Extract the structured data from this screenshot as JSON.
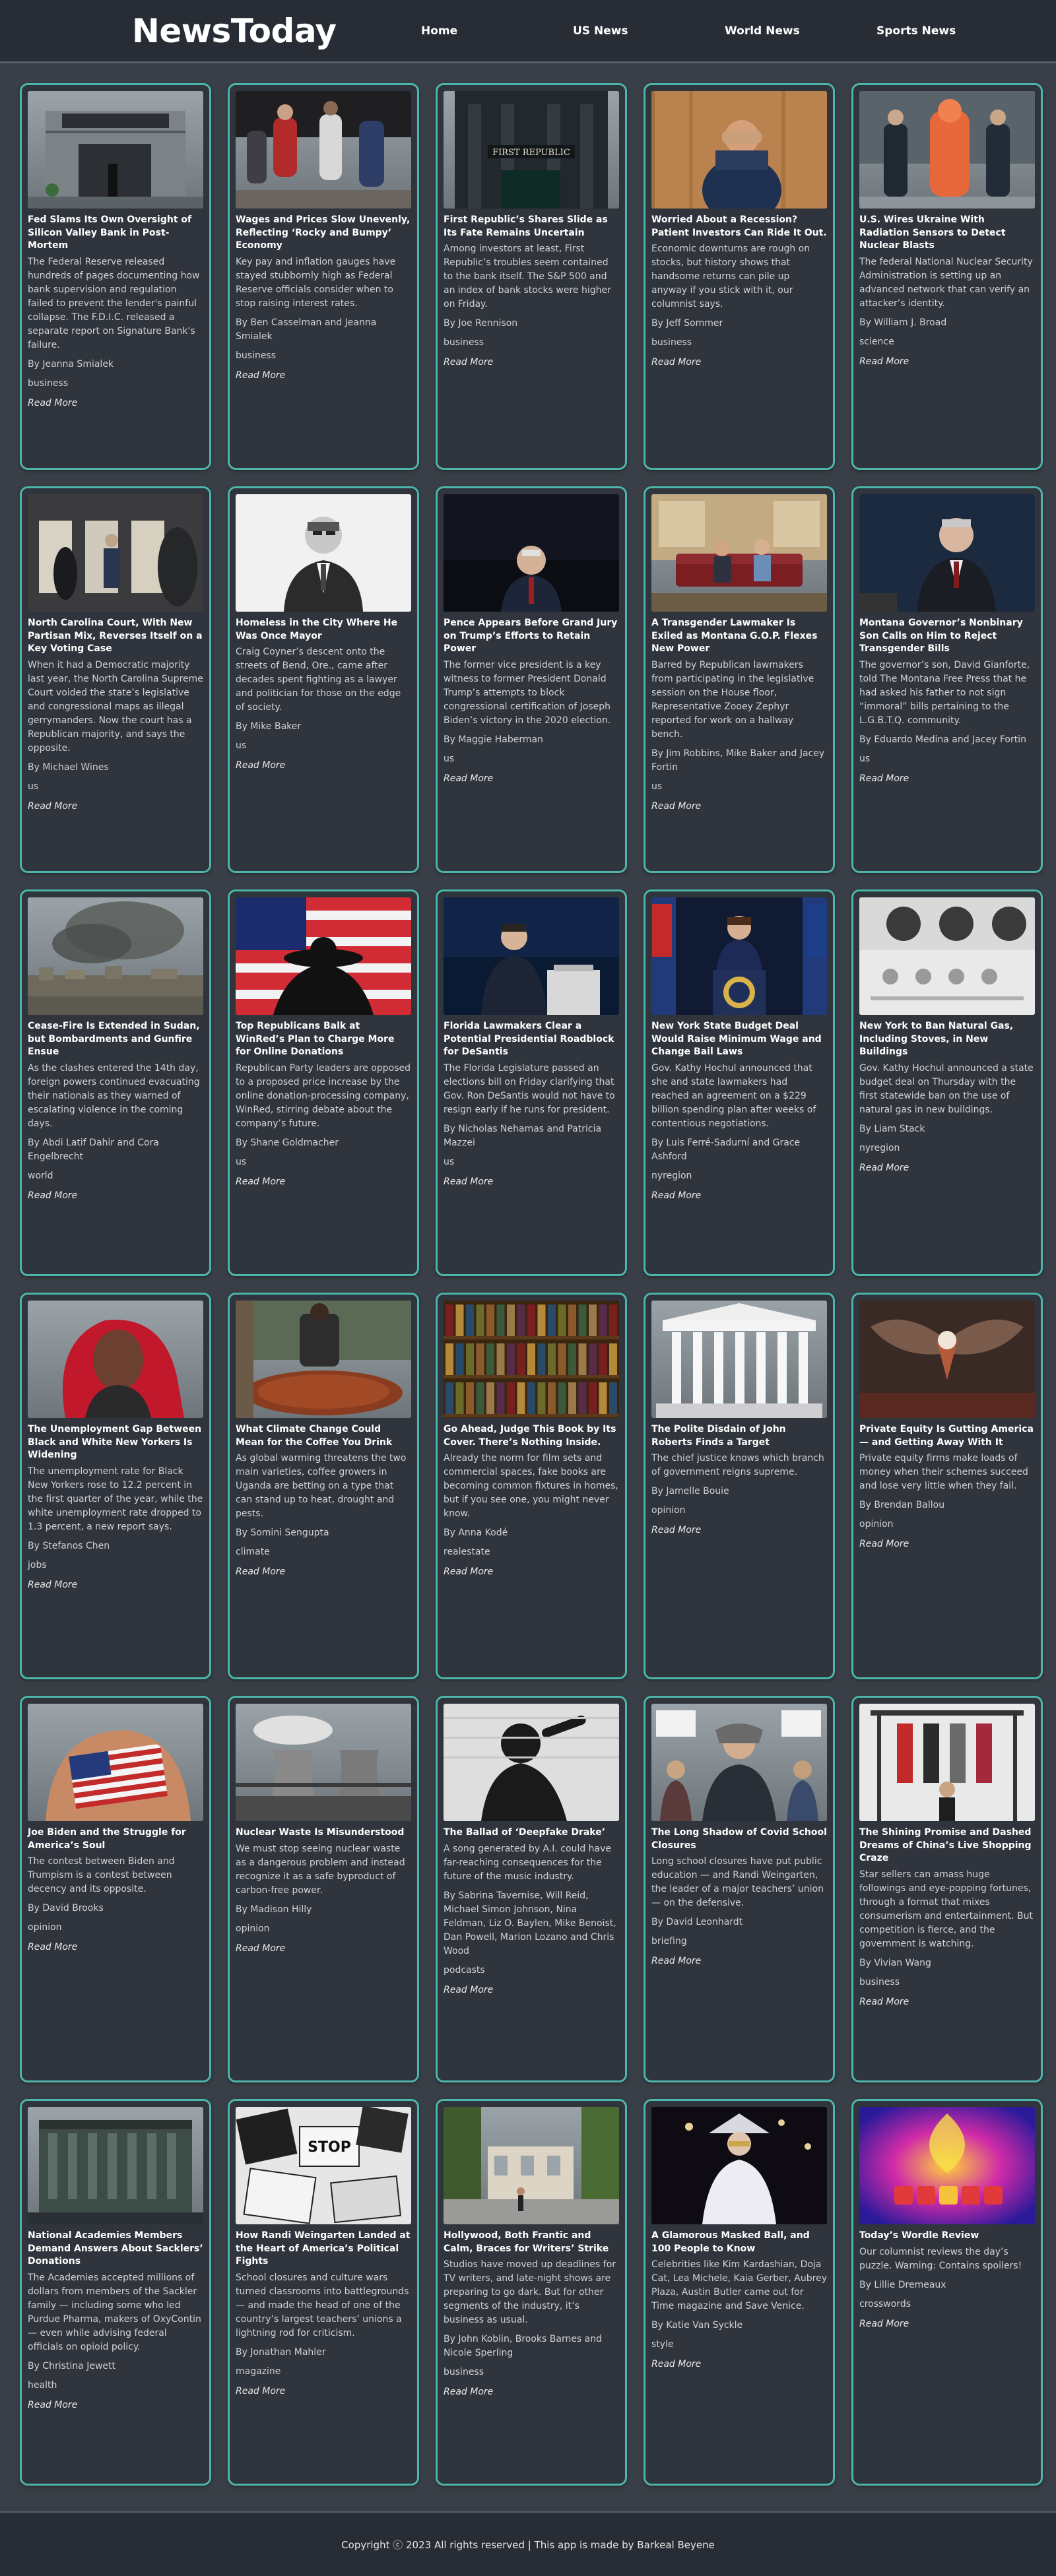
{
  "header": {
    "brand": "NewsToday",
    "nav": [
      "Home",
      "US News",
      "World News",
      "Sports News"
    ]
  },
  "read_more_label": "Read More",
  "articles": [
    {
      "title": "Fed Slams Its Own Oversight of Silicon Valley Bank in Post-Mortem",
      "summary": "The Federal Reserve released hundreds of pages documenting how bank supervision and regulation failed to prevent the lender's painful collapse. The F.D.I.C. released a separate report on Signature Bank's failure.",
      "byline": "By Jeanna Smialek",
      "section": "business",
      "image": "bank-building",
      "sign": "Silicon Valley Bank"
    },
    {
      "title": "Wages and Prices Slow Unevenly, Reflecting ‘Rocky and Bumpy’ Economy",
      "summary": "Key pay and inflation gauges have stayed stubbornly high as Federal Reserve officials consider when to stop raising interest rates.",
      "byline": "By Ben Casselman and Jeanna Smialek",
      "section": "business",
      "image": "street-pedestrians"
    },
    {
      "title": "First Republic’s Shares Slide as Its Fate Remains Uncertain",
      "summary": "Among investors at least, First Republic’s troubles seem contained to the bank itself. The S&P 500 and an index of bank stocks were higher on Friday.",
      "byline": "By Joe Rennison",
      "section": "business",
      "image": "bank-facade",
      "sign": "FIRST REPUBLIC"
    },
    {
      "title": "Worried About a Recession? Patient Investors Can Ride It Out.",
      "summary": "Economic downturns are rough on stocks, but history shows that handsome returns can pile up anyway if you stick with it, our columnist says.",
      "byline": "By Jeff Sommer",
      "section": "business",
      "image": "worried-man"
    },
    {
      "title": "U.S. Wires Ukraine With Radiation Sensors to Detect Nuclear Blasts",
      "summary": "The federal National Nuclear Security Administration is setting up an advanced network that can verify an attacker’s identity.",
      "byline": "By William J. Broad",
      "section": "science",
      "image": "hazmat-suits"
    },
    {
      "title": "North Carolina Court, With New Partisan Mix, Reverses Itself on a Key Voting Case",
      "summary": "When it had a Democratic majority last year, the North Carolina Supreme Court voided the state’s legislative and congressional maps as illegal gerrymanders. Now the court has a Republican majority, and says the opposite.",
      "byline": "By Michael Wines",
      "section": "us",
      "image": "voting-booths"
    },
    {
      "title": "Homeless in the City Where He Was Once Mayor",
      "summary": "Craig Coyner’s descent onto the streets of Bend, Ore., came after decades spent fighting as a lawyer and politician for those on the edge of society.",
      "byline": "By Mike Baker",
      "section": "us",
      "image": "bw-portrait"
    },
    {
      "title": "Pence Appears Before Grand Jury on Trump’s Efforts to Retain Power",
      "summary": "The former vice president is a key witness to former President Donald Trump’s attempts to block congressional certification of Joseph Biden’s victory in the 2020 election.",
      "byline": "By Maggie Haberman",
      "section": "us",
      "image": "speaker-dark"
    },
    {
      "title": "A Transgender Lawmaker Is Exiled as Montana G.O.P. Flexes New Power",
      "summary": "Barred by Republican lawmakers from participating in the legislative session on the House floor, Representative Zooey Zephyr reported for work on a hallway bench.",
      "byline": "By Jim Robbins, Mike Baker and Jacey Fortin",
      "section": "us",
      "image": "bench"
    },
    {
      "title": "Montana Governor’s Nonbinary Son Calls on Him to Reject Transgender Bills",
      "summary": "The governor’s son, David Gianforte, told The Montana Free Press that he had asked his father to not sign “immoral” bills pertaining to the L.G.B.T.Q. community.",
      "byline": "By Eduardo Medina and Jacey Fortin",
      "section": "us",
      "image": "governor"
    },
    {
      "title": "Cease-Fire Is Extended in Sudan, but Bombardments and Gunfire Ensue",
      "summary": "As the clashes entered the 14th day, foreign powers continued evacuating their nationals as they warned of escalating violence in the coming days.",
      "byline": "By Abdi Latif Dahir and Cora Engelbrecht",
      "section": "world",
      "image": "smoke-city"
    },
    {
      "title": "Top Republicans Balk at WinRed’s Plan to Charge More for Online Donations",
      "summary": "Republican Party leaders are opposed to a proposed price increase by the online donation-processing company, WinRed, stirring debate about the company’s future.",
      "byline": "By Shane Goldmacher",
      "section": "us",
      "image": "flag-silhouette"
    },
    {
      "title": "Florida Lawmakers Clear a Potential Presidential Roadblock for DeSantis",
      "summary": "The Florida Legislature passed an elections bill on Friday clarifying that Gov. Ron DeSantis would not have to resign early if he runs for president.",
      "byline": "By Nicholas Nehamas and Patricia Mazzei",
      "section": "us",
      "image": "podium-speaker"
    },
    {
      "title": "New York State Budget Deal Would Raise Minimum Wage and Change Bail Laws",
      "summary": "Gov. Kathy Hochul announced that she and state lawmakers had reached an agreement on a $229 billion spending plan after weeks of contentious negotiations.",
      "byline": "By Luis Ferré-Sadurní and Grace Ashford",
      "section": "nyregion",
      "image": "governor-podium"
    },
    {
      "title": "New York to Ban Natural Gas, Including Stoves, in New Buildings",
      "summary": "Gov. Kathy Hochul announced a state budget deal on Thursday with the first statewide ban on the use of natural gas in new buildings.",
      "byline": "By Liam Stack",
      "section": "nyregion",
      "image": "gas-stove"
    },
    {
      "title": "The Unemployment Gap Between Black and White New Yorkers Is Widening",
      "summary": "The unemployment rate for Black New Yorkers rose to 12.2 percent in the first quarter of the year, while the white unemployment rate dropped to 1.3 percent, a new report says.",
      "byline": "By Stefanos Chen",
      "section": "jobs",
      "image": "red-hair"
    },
    {
      "title": "What Climate Change Could Mean for the Coffee You Drink",
      "summary": "As global warming threatens the two main varieties, coffee growers in Uganda are betting on a type that can stand up to heat, drought and pests.",
      "byline": "By Somini Sengupta",
      "section": "climate",
      "image": "coffee-beans"
    },
    {
      "title": "Go Ahead, Judge This Book by Its Cover. There’s Nothing Inside.",
      "summary": "Already the norm for film sets and commercial spaces, fake books are becoming common fixtures in homes, but if you see one, you might never know.",
      "byline": "By Anna Kodé",
      "section": "realestate",
      "image": "bookshelf"
    },
    {
      "title": "The Polite Disdain of John Roberts Finds a Target",
      "summary": "The chief justice knows which branch of government reigns supreme.",
      "byline": "By Jamelle Bouie",
      "section": "opinion",
      "image": "supreme-court"
    },
    {
      "title": "Private Equity Is Gutting America — and Getting Away With It",
      "summary": "Private equity firms make loads of money when their schemes succeed and lose very little when they fail.",
      "byline": "By Brendan Ballou",
      "section": "opinion",
      "image": "eagle-illustration"
    },
    {
      "title": "Joe Biden and the Struggle for America’s Soul",
      "summary": "The contest between Biden and Trumpism is a contest between decency and its opposite.",
      "byline": "By David Brooks",
      "section": "opinion",
      "image": "flag-patch"
    },
    {
      "title": "Nuclear Waste Is Misunderstood",
      "summary": "We must stop seeing nuclear waste as a dangerous problem and instead recognize it as a safe byproduct of carbon-free power.",
      "byline": "By Madison Hilly",
      "section": "opinion",
      "image": "cooling-towers"
    },
    {
      "title": "The Ballad of ‘Deepfake Drake’",
      "summary": "A song generated by A.I. could have far-reaching consequences for the future of the music industry.",
      "byline": "By Sabrina Tavernise, Will Reid, Michael Simon Johnson, Nina Feldman, Liz O. Baylen, Mike Benoist, Dan Powell, Marion Lozano and Chris Wood",
      "section": "podcasts",
      "image": "singer-silhouette"
    },
    {
      "title": "The Long Shadow of Covid School Closures",
      "summary": "Long school closures have put public education — and Randi Weingarten, the leader of a major teachers’ union — on the defensive.",
      "byline": "By David Leonhardt",
      "section": "briefing",
      "image": "protest"
    },
    {
      "title": "The Shining Promise and Dashed Dreams of China’s Live Shopping Craze",
      "summary": "Star sellers can amass huge followings and eye-popping fortunes, through a format that mixes consumerism and entertainment. But competition is fierce, and the government is watching.",
      "byline": "By Vivian Wang",
      "section": "business",
      "image": "studio-racks"
    },
    {
      "title": "National Academies Members Demand Answers About Sacklers’ Donations",
      "summary": "The Academies accepted millions of dollars from members of the Sackler family — including some who led Purdue Pharma, makers of OxyContin — even while advising federal officials on opioid policy.",
      "byline": "By Christina Jewett",
      "section": "health",
      "image": "academy-building"
    },
    {
      "title": "How Randi Weingarten Landed at the Heart of America’s Political Fights",
      "summary": "School closures and culture wars turned classrooms into battlegrounds — and made the head of one of the country’s largest teachers’ unions a lightning rod for criticism.",
      "byline": "By Jonathan Mahler",
      "section": "magazine",
      "image": "protest-signs",
      "sign": "STOP"
    },
    {
      "title": "Hollywood, Both Frantic and Calm, Braces for Writers’ Strike",
      "summary": "Studios have moved up deadlines for TV writers, and late-night shows are preparing to go dark. But for other segments of the industry, it’s business as usual.",
      "byline": "By John Koblin, Brooks Barnes and Nicole Sperling",
      "section": "business",
      "image": "studio-lot"
    },
    {
      "title": "A Glamorous Masked Ball, and 100 People to Know",
      "summary": "Celebrities like Kim Kardashian, Doja Cat, Lea Michele, Kaia Gerber, Aubrey Plaza, Austin Butler came out for Time magazine and Save Venice.",
      "byline": "By Katie Van Syckle",
      "section": "style",
      "image": "masked-ball"
    },
    {
      "title": "Today’s Wordle Review",
      "summary": "Our columnist reviews the day’s puzzle. Warning: Contains spoilers!",
      "byline": "By Lillie Dremeaux",
      "section": "crosswords",
      "image": "wordle-art"
    }
  ],
  "footer": {
    "text": "Copyright ⓒ 2023 All rights reserved | This app is made by Barkeal Beyene"
  }
}
